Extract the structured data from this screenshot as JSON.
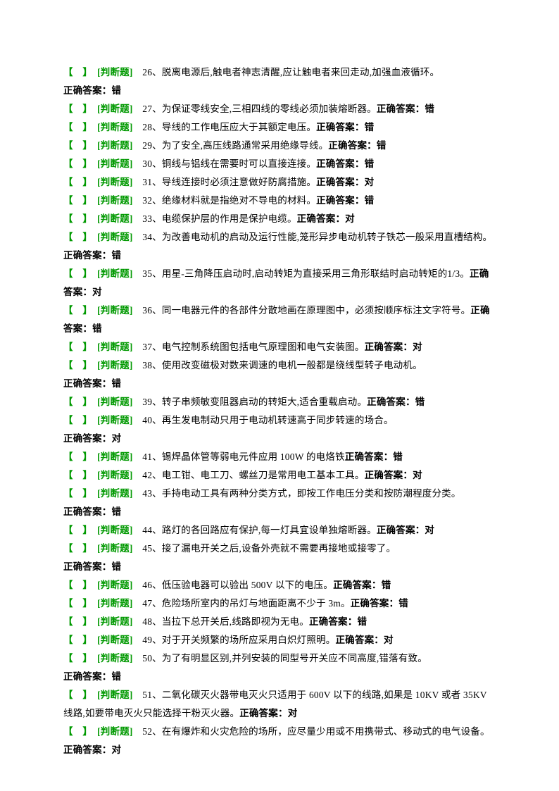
{
  "prefix": "【　】",
  "tag": "[判断题]",
  "ans_label": "正确答案：",
  "items": [
    {
      "n": "26",
      "q": "脱离电源后,触电者神志清醒,应让触电者来回走动,加强血液循环。",
      "a": "错",
      "br_before_ans": true
    },
    {
      "n": "27",
      "q": "为保证零线安全,三相四线的零线必须加装熔断器。",
      "a": "错"
    },
    {
      "n": "28",
      "q": "导线的工作电压应大于其额定电压。",
      "a": "错"
    },
    {
      "n": "29",
      "q": "为了安全,高压线路通常采用绝缘导线。",
      "a": "错"
    },
    {
      "n": "30",
      "q": "铜线与铝线在需要时可以直接连接。",
      "a": "错"
    },
    {
      "n": "31",
      "q": "导线连接时必须注意做好防腐措施。",
      "a": "对"
    },
    {
      "n": "32",
      "q": "绝缘材料就是指绝对不导电的材料。",
      "a": "错"
    },
    {
      "n": "33",
      "q": "电缆保护层的作用是保护电缆。",
      "a": "对"
    },
    {
      "n": "34",
      "q": "为改善电动机的启动及运行性能,笼形异步电动机转子铁芯一般采用直槽结构。",
      "a": "错",
      "br_before_ans": false,
      "wrap": true
    },
    {
      "n": "35",
      "q": "用星-三角降压启动时,启动转矩为直接采用三角形联结时启动转矩的1/3。",
      "a": "对",
      "wrap": true
    },
    {
      "n": "36",
      "q": "同一电器元件的各部件分散地画在原理图中，必须按顺序标注文字符号。",
      "a": "错",
      "wrap": true
    },
    {
      "n": "37",
      "q": "电气控制系统图包括电气原理图和电气安装图。",
      "a": "对"
    },
    {
      "n": "38",
      "q": "使用改变磁极对数来调速的电机一般都是绕线型转子电动机。",
      "a": "错",
      "wrap": true,
      "ans_wrap": true
    },
    {
      "n": "39",
      "q": "转子串频敏变阻器启动的转矩大,适合重载启动。",
      "a": "错"
    },
    {
      "n": "40",
      "q": "再生发电制动只用于电动机转速高于同步转速的场合。",
      "a": "对",
      "wrap": true,
      "ans_wrap": true
    },
    {
      "n": "41",
      "q": "锡焊晶体管等弱电元件应用 100W 的电烙铁",
      "a": "错"
    },
    {
      "n": "42",
      "q": "电工钳、电工刀、螺丝刀是常用电工基本工具。",
      "a": "对"
    },
    {
      "n": "43",
      "q": "手持电动工具有两种分类方式，即按工作电压分类和按防潮程度分类。",
      "a": "错",
      "br_before_ans": true
    },
    {
      "n": "44",
      "q": "路灯的各回路应有保护,每一灯具宜设单独熔断器。",
      "a": "对"
    },
    {
      "n": "45",
      "q": "接了漏电开关之后,设备外壳就不需要再接地或接零了。",
      "a": "错",
      "wrap": true,
      "ans_wrap": true
    },
    {
      "n": "46",
      "q": "低压验电器可以验出 500V 以下的电压。",
      "a": "错"
    },
    {
      "n": "47",
      "q": "危险场所室内的吊灯与地面距离不少于 3m。",
      "a": "错"
    },
    {
      "n": "48",
      "q": "当拉下总开关后,线路即视为无电。",
      "a": "错"
    },
    {
      "n": "49",
      "q": "对于开关频繁的场所应采用白炽灯照明。",
      "a": "对"
    },
    {
      "n": "50",
      "q": "为了有明显区别,并列安装的同型号开关应不同高度,错落有致。",
      "a": "错",
      "wrap": true,
      "ans_wrap": true
    },
    {
      "n": "51",
      "q": "二氧化碳灭火器带电灭火只适用于 600V 以下的线路,如果是 10KV 或者 35KV 线路,如要带电灭火只能选择干粉灭火器。",
      "a": "对",
      "wrap": true
    },
    {
      "n": "52",
      "q": "在有爆炸和火灾危险的场所，应尽量少用或不用携带式、移动式的电气设备。",
      "a": "对",
      "wrap": true
    }
  ]
}
